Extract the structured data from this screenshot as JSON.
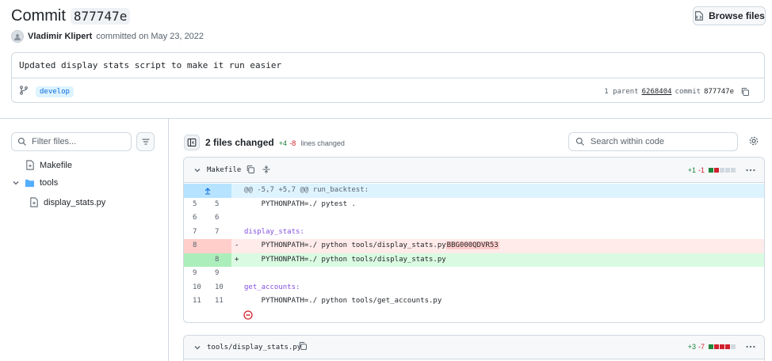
{
  "header": {
    "title_prefix": "Commit",
    "sha": "877747e",
    "browse_label": "Browse files",
    "author": "Vladimir Klipert",
    "committed_text": "committed on May 23, 2022"
  },
  "commit": {
    "message": "Updated display stats script to make it run easier",
    "branch": "develop",
    "parent_label": "1 parent",
    "parent_sha": "6268404",
    "commit_label": "commit",
    "commit_sha": "877747e"
  },
  "sidebar": {
    "filter_placeholder": "Filter files...",
    "tree": [
      {
        "label": "Makefile",
        "type": "file"
      },
      {
        "label": "tools",
        "type": "folder"
      },
      {
        "label": "display_stats.py",
        "type": "file"
      }
    ]
  },
  "diff_toolbar": {
    "files_changed": "2 files changed",
    "additions": "+4",
    "deletions": "-8",
    "lines_label": "lines changed",
    "search_placeholder": "Search within code"
  },
  "files": [
    {
      "name": "Makefile",
      "additions": "+1",
      "deletions": "-1",
      "bar": [
        "add",
        "del",
        "neu",
        "neu",
        "neu"
      ],
      "hunk": "@@ -5,7 +5,7 @@ run_backtest:",
      "rows": [
        {
          "type": "ctx",
          "old": "5",
          "new": "5",
          "sign": "",
          "code": "    PYTHONPATH=./ pytest ."
        },
        {
          "type": "ctx",
          "old": "6",
          "new": "6",
          "sign": "",
          "code": ""
        },
        {
          "type": "ctx",
          "old": "7",
          "new": "7",
          "sign": "",
          "code": "display_stats:"
        },
        {
          "type": "del",
          "old": "8",
          "new": "",
          "sign": "-",
          "code": "    PYTHONPATH=./ python tools/display_stats.py",
          "highlight": "BBG000QDVR53"
        },
        {
          "type": "ins",
          "old": "",
          "new": "8",
          "sign": "+",
          "code": "    PYTHONPATH=./ python tools/display_stats.py"
        },
        {
          "type": "ctx",
          "old": "9",
          "new": "9",
          "sign": "",
          "code": ""
        },
        {
          "type": "ctx",
          "old": "10",
          "new": "10",
          "sign": "",
          "code": "get_accounts:"
        },
        {
          "type": "ctx",
          "old": "11",
          "new": "11",
          "sign": "",
          "code": "    PYTHONPATH=./ python tools/get_accounts.py"
        }
      ]
    },
    {
      "name": "tools/display_stats.py",
      "additions": "+3",
      "deletions": "-7",
      "bar": [
        "add",
        "del",
        "del",
        "del",
        "neu"
      ]
    }
  ],
  "colors": {
    "accent": "#0969da",
    "add": "#1a7f37",
    "del": "#d1242f"
  }
}
